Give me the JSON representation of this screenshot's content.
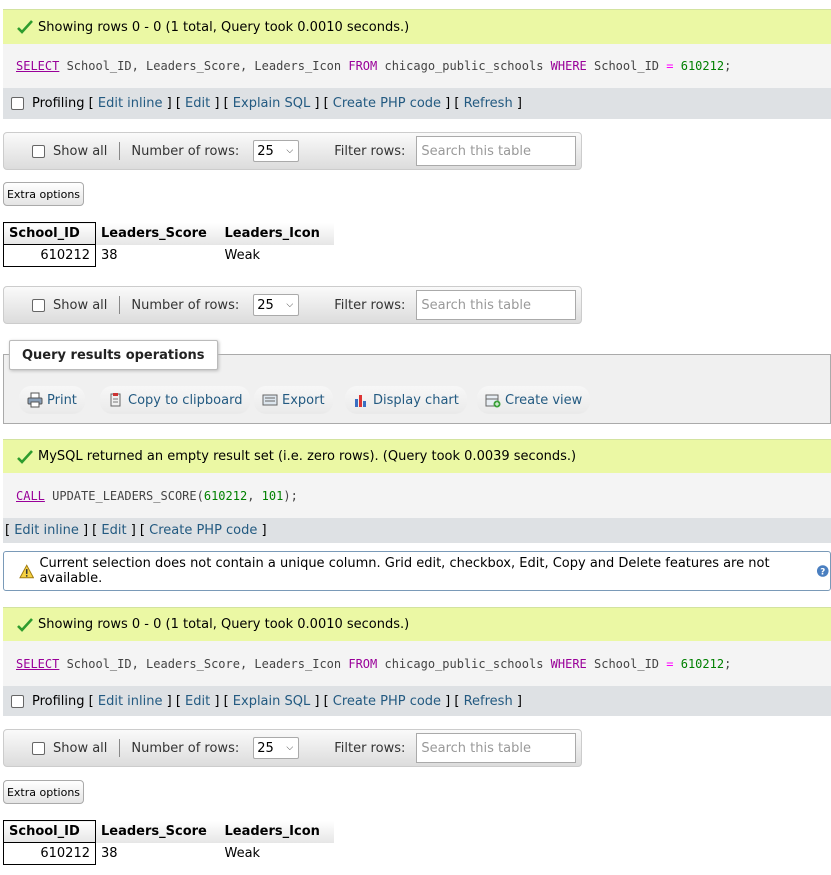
{
  "result1": {
    "status": "Showing rows 0 - 0 (1 total, Query took 0.0010 seconds.)",
    "sql": {
      "select": "SELECT",
      "cols": " School_ID, Leaders_Score, Leaders_Icon ",
      "from": "FROM",
      "table": " chicago_public_schools ",
      "where": "WHERE",
      "cond": " School_ID ",
      "eq": "=",
      "val": "610212",
      "end": ";"
    }
  },
  "tools": {
    "profiling": "Profiling",
    "edit_inline": "Edit inline",
    "edit": "Edit",
    "explain": "Explain SQL",
    "create_php": "Create PHP code",
    "refresh": "Refresh"
  },
  "nav": {
    "show_all": "Show all",
    "number_of_rows": "Number of rows:",
    "rows_value": "25",
    "filter_rows": "Filter rows:",
    "filter_placeholder": "Search this table"
  },
  "extra_options": "Extra options",
  "table": {
    "headers": [
      "School_ID",
      "Leaders_Score",
      "Leaders_Icon"
    ],
    "row": [
      "610212",
      "38",
      "Weak"
    ]
  },
  "ops": {
    "legend": "Query results operations",
    "print": "Print",
    "copy": "Copy to clipboard",
    "export": "Export",
    "display_chart": "Display chart",
    "create_view": "Create view"
  },
  "result2": {
    "status": "MySQL returned an empty result set (i.e. zero rows). (Query took 0.0039 seconds.)",
    "sql": {
      "call": "CALL",
      "proc": " UPDATE_LEADERS_SCORE(",
      "a1": "610212",
      "comma": ", ",
      "a2": "101",
      "end": ");"
    }
  },
  "notice": "Current selection does not contain a unique column. Grid edit, checkbox, Edit, Copy and Delete features are not available.",
  "colors": {
    "success_bg": "#ebf8a4",
    "link": "#235a81",
    "keyword": "#990099",
    "number": "#008000"
  }
}
